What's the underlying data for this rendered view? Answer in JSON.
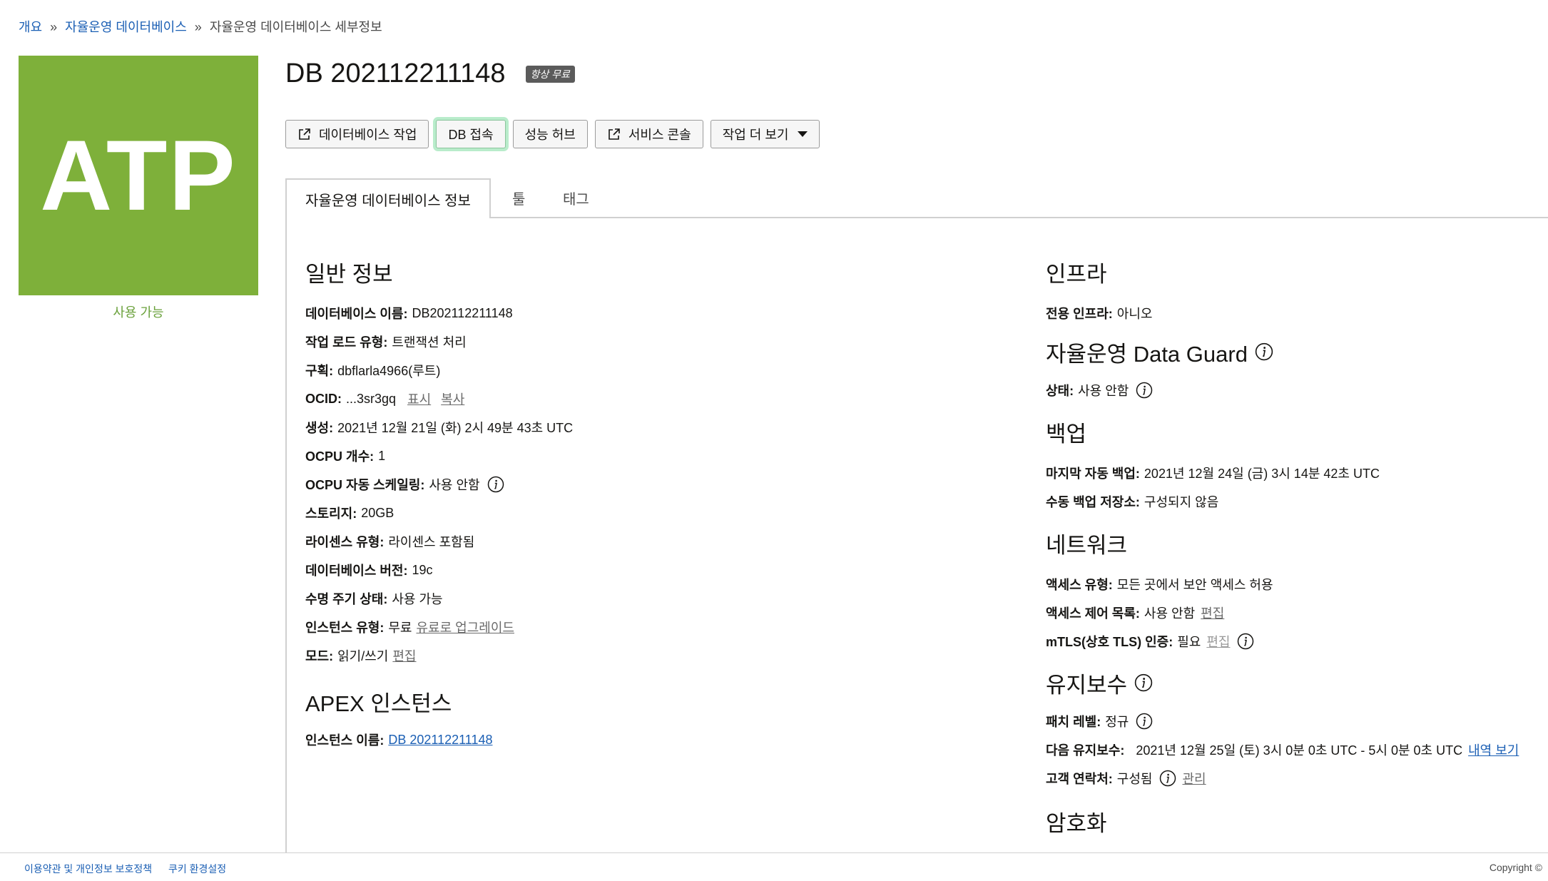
{
  "breadcrumb": {
    "items": [
      "개요",
      "자율운영 데이터베이스"
    ],
    "separator": "»",
    "current": "자율운영 데이터베이스 세부정보"
  },
  "tile": {
    "text": "ATP",
    "color": "#7eb03a",
    "status": "사용 가능"
  },
  "header": {
    "title": "DB 202112211148",
    "badge": "항상 무료"
  },
  "toolbar": {
    "db_actions": "데이터베이스 작업",
    "db_connect": "DB 접속",
    "performance_hub": "성능 허브",
    "service_console": "서비스 콘솔",
    "more_actions": "작업 더 보기"
  },
  "tabs": {
    "info": "자율운영 데이터베이스 정보",
    "tools": "툴",
    "tags": "태그"
  },
  "general": {
    "title": "일반 정보",
    "db_name_label": "데이터베이스 이름:",
    "db_name": "DB202112211148",
    "workload_label": "작업 로드 유형:",
    "workload": "트랜잭션 처리",
    "compartment_label": "구획:",
    "compartment": "dbflarla4966(루트)",
    "ocid_label": "OCID:",
    "ocid": "...3sr3gq",
    "ocid_show": "표시",
    "ocid_copy": "복사",
    "created_label": "생성:",
    "created": "2021년 12월 21일 (화) 2시 49분 43초 UTC",
    "ocpu_count_label": "OCPU 개수:",
    "ocpu_count": "1",
    "autoscale_label": "OCPU 자동 스케일링:",
    "autoscale": "사용 안함",
    "storage_label": "스토리지:",
    "storage": "20GB",
    "license_label": "라이센스 유형:",
    "license": "라이센스 포함됨",
    "version_label": "데이터베이스 버전:",
    "version": "19c",
    "lifecycle_label": "수명 주기 상태:",
    "lifecycle": "사용 가능",
    "instance_type_label": "인스턴스 유형:",
    "instance_type": "무료",
    "upgrade_link": "유료로 업그레이드",
    "mode_label": "모드:",
    "mode": "읽기/쓰기",
    "mode_edit": "편집"
  },
  "apex": {
    "title": "APEX 인스턴스",
    "instance_label": "인스턴스 이름:",
    "instance": "DB 202112211148"
  },
  "infra": {
    "title": "인프라",
    "dedicated_label": "전용 인프라:",
    "dedicated": "아니오"
  },
  "dataguard": {
    "title": "자율운영 Data Guard",
    "status_label": "상태:",
    "status": "사용 안함"
  },
  "backup": {
    "title": "백업",
    "last_label": "마지막 자동 백업:",
    "last": "2021년 12월 24일 (금) 3시 14분 42초 UTC",
    "manual_label": "수동 백업 저장소:",
    "manual": "구성되지 않음"
  },
  "network": {
    "title": "네트워크",
    "access_label": "액세스 유형:",
    "access": "모든 곳에서 보안 액세스 허용",
    "acl_label": "액세스 제어 목록:",
    "acl": "사용 안함",
    "acl_edit": "편집",
    "mtls_label": "mTLS(상호 TLS) 인증:",
    "mtls": "필요",
    "mtls_edit": "편집"
  },
  "maintenance": {
    "title": "유지보수",
    "patch_label": "패치 레벨:",
    "patch": "정규",
    "next_label": "다음 유지보수:",
    "next": "2021년 12월 25일 (토) 3시 0분 0초 UTC - 5시 0분 0초 UTC",
    "history_link": "내역 보기",
    "contact_label": "고객 연락처:",
    "contact": "구성됨",
    "contact_manage": "관리"
  },
  "encryption": {
    "title": "암호화"
  },
  "footer": {
    "terms": "이용약관 및 개인정보 보호정책",
    "cookies": "쿠키 환경설정",
    "copyright": "Copyright ©"
  }
}
